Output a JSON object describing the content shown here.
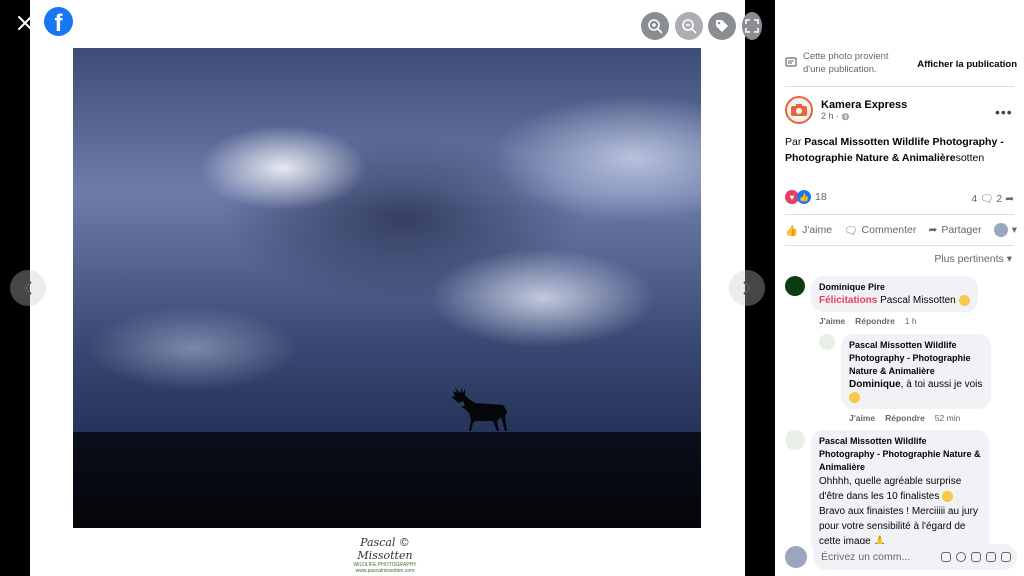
{
  "viewer": {
    "signature": {
      "script": "Pascal © Missotten",
      "line1": "WILDLIFE PHOTOGRAPHY",
      "line2": "www.pascalmissotten.com"
    }
  },
  "panel": {
    "note_text": "Cette photo provient d'une publication.",
    "note_link": "Afficher la publication",
    "author_name": "Kamera Express",
    "author_time": "2 h ·",
    "caption_prefix": "Par ",
    "caption_bold": "Pascal Missotten Wildlife Photography - Photographie Nature & Animalière",
    "caption_suffix": "sotten",
    "reaction_count": "18",
    "comment_count": "4",
    "share_count": "2",
    "actions": {
      "like": "J'aime",
      "comment": "Commenter",
      "share": "Partager"
    },
    "sort_label": "Plus pertinents",
    "comments": [
      {
        "name": "Dominique Pire",
        "tag": "Félicitations",
        "text": " Pascal Missotten",
        "like": "J'aime",
        "reply": "Répondre",
        "time": "1 h"
      },
      {
        "name": "Pascal Missotten Wildlife Photography - Photographie Nature & Animalière",
        "tag": "Dominique",
        "text": ", à toi aussi je vois",
        "like": "J'aime",
        "reply": "Répondre",
        "time": "52 min"
      },
      {
        "name": "Pascal Missotten Wildlife Photography - Photographie Nature & Animalière",
        "text": "Ohhhh, quelle agréable surprise d'être dans les 10 finalistes",
        "text2": "Bravo aux finaistes ! Merciiiii au jury pour votre sensibilité à l'égard de cette image"
      }
    ],
    "composer_placeholder": "Écrivez un comm..."
  },
  "colors": {
    "facebook_blue": "#1877f2",
    "accent_red": "#e4405f"
  }
}
